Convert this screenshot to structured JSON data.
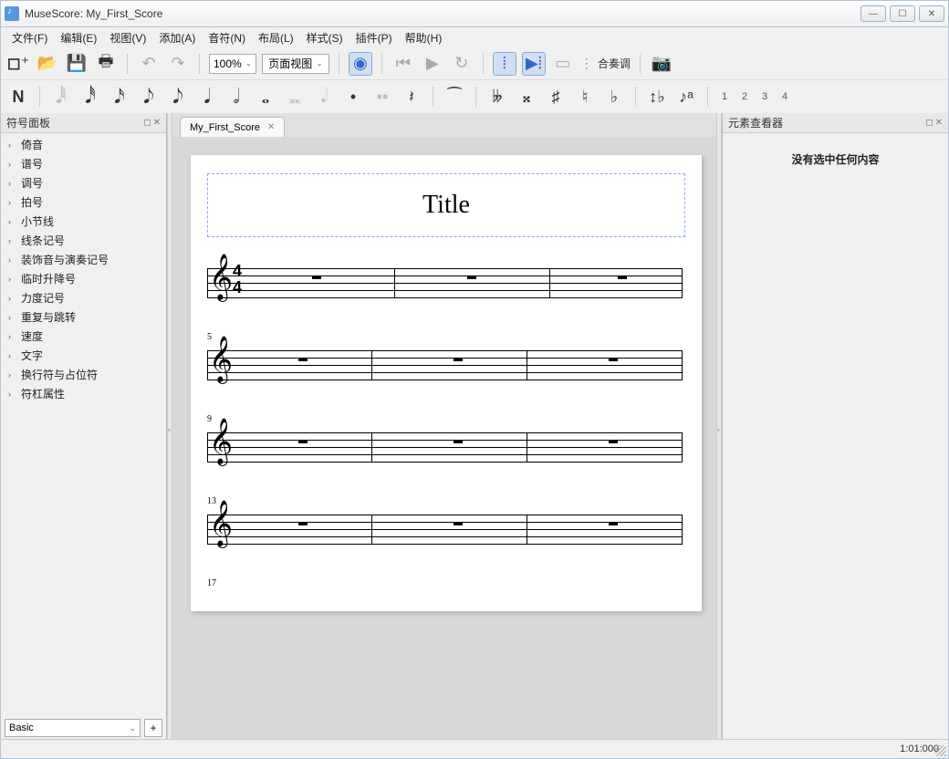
{
  "app_title": "MuseScore: My_First_Score",
  "menu": {
    "file": "文件(F)",
    "edit": "编辑(E)",
    "view": "视图(V)",
    "add": "添加(A)",
    "notes": "音符(N)",
    "layout": "布局(L)",
    "style": "样式(S)",
    "plugins": "插件(P)",
    "help": "帮助(H)"
  },
  "toolbar": {
    "zoom": "100%",
    "view_mode": "页面视图",
    "concert_pitch": "合奏调"
  },
  "voice_numbers": [
    "1",
    "2",
    "3",
    "4"
  ],
  "palette": {
    "title": "符号面板",
    "items": [
      "倚音",
      "谱号",
      "调号",
      "拍号",
      "小节线",
      "线条记号",
      "装饰音与演奏记号",
      "临时升降号",
      "力度记号",
      "重复与跳转",
      "速度",
      "文字",
      "换行符与占位符",
      "符杠属性"
    ],
    "workspace": "Basic"
  },
  "score_tab": {
    "name": "My_First_Score"
  },
  "score": {
    "title": "Title",
    "time_sig_num": "4",
    "time_sig_den": "4",
    "measure_numbers": [
      "",
      "5",
      "9",
      "13",
      "17"
    ]
  },
  "inspector": {
    "title": "元素查看器",
    "empty_text": "没有选中任何内容"
  },
  "status": {
    "position": "1:01:000"
  }
}
